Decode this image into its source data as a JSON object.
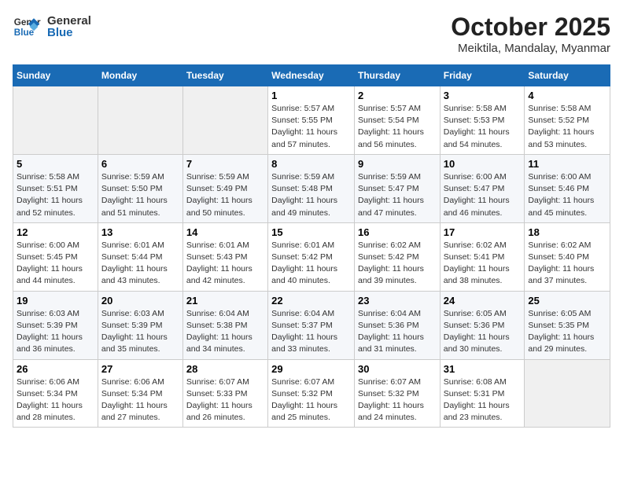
{
  "header": {
    "logo_line1": "General",
    "logo_line2": "Blue",
    "month": "October 2025",
    "location": "Meiktila, Mandalay, Myanmar"
  },
  "days_of_week": [
    "Sunday",
    "Monday",
    "Tuesday",
    "Wednesday",
    "Thursday",
    "Friday",
    "Saturday"
  ],
  "weeks": [
    [
      {
        "day": "",
        "info": ""
      },
      {
        "day": "",
        "info": ""
      },
      {
        "day": "",
        "info": ""
      },
      {
        "day": "1",
        "info": "Sunrise: 5:57 AM\nSunset: 5:55 PM\nDaylight: 11 hours and 57 minutes."
      },
      {
        "day": "2",
        "info": "Sunrise: 5:57 AM\nSunset: 5:54 PM\nDaylight: 11 hours and 56 minutes."
      },
      {
        "day": "3",
        "info": "Sunrise: 5:58 AM\nSunset: 5:53 PM\nDaylight: 11 hours and 54 minutes."
      },
      {
        "day": "4",
        "info": "Sunrise: 5:58 AM\nSunset: 5:52 PM\nDaylight: 11 hours and 53 minutes."
      }
    ],
    [
      {
        "day": "5",
        "info": "Sunrise: 5:58 AM\nSunset: 5:51 PM\nDaylight: 11 hours and 52 minutes."
      },
      {
        "day": "6",
        "info": "Sunrise: 5:59 AM\nSunset: 5:50 PM\nDaylight: 11 hours and 51 minutes."
      },
      {
        "day": "7",
        "info": "Sunrise: 5:59 AM\nSunset: 5:49 PM\nDaylight: 11 hours and 50 minutes."
      },
      {
        "day": "8",
        "info": "Sunrise: 5:59 AM\nSunset: 5:48 PM\nDaylight: 11 hours and 49 minutes."
      },
      {
        "day": "9",
        "info": "Sunrise: 5:59 AM\nSunset: 5:47 PM\nDaylight: 11 hours and 47 minutes."
      },
      {
        "day": "10",
        "info": "Sunrise: 6:00 AM\nSunset: 5:47 PM\nDaylight: 11 hours and 46 minutes."
      },
      {
        "day": "11",
        "info": "Sunrise: 6:00 AM\nSunset: 5:46 PM\nDaylight: 11 hours and 45 minutes."
      }
    ],
    [
      {
        "day": "12",
        "info": "Sunrise: 6:00 AM\nSunset: 5:45 PM\nDaylight: 11 hours and 44 minutes."
      },
      {
        "day": "13",
        "info": "Sunrise: 6:01 AM\nSunset: 5:44 PM\nDaylight: 11 hours and 43 minutes."
      },
      {
        "day": "14",
        "info": "Sunrise: 6:01 AM\nSunset: 5:43 PM\nDaylight: 11 hours and 42 minutes."
      },
      {
        "day": "15",
        "info": "Sunrise: 6:01 AM\nSunset: 5:42 PM\nDaylight: 11 hours and 40 minutes."
      },
      {
        "day": "16",
        "info": "Sunrise: 6:02 AM\nSunset: 5:42 PM\nDaylight: 11 hours and 39 minutes."
      },
      {
        "day": "17",
        "info": "Sunrise: 6:02 AM\nSunset: 5:41 PM\nDaylight: 11 hours and 38 minutes."
      },
      {
        "day": "18",
        "info": "Sunrise: 6:02 AM\nSunset: 5:40 PM\nDaylight: 11 hours and 37 minutes."
      }
    ],
    [
      {
        "day": "19",
        "info": "Sunrise: 6:03 AM\nSunset: 5:39 PM\nDaylight: 11 hours and 36 minutes."
      },
      {
        "day": "20",
        "info": "Sunrise: 6:03 AM\nSunset: 5:39 PM\nDaylight: 11 hours and 35 minutes."
      },
      {
        "day": "21",
        "info": "Sunrise: 6:04 AM\nSunset: 5:38 PM\nDaylight: 11 hours and 34 minutes."
      },
      {
        "day": "22",
        "info": "Sunrise: 6:04 AM\nSunset: 5:37 PM\nDaylight: 11 hours and 33 minutes."
      },
      {
        "day": "23",
        "info": "Sunrise: 6:04 AM\nSunset: 5:36 PM\nDaylight: 11 hours and 31 minutes."
      },
      {
        "day": "24",
        "info": "Sunrise: 6:05 AM\nSunset: 5:36 PM\nDaylight: 11 hours and 30 minutes."
      },
      {
        "day": "25",
        "info": "Sunrise: 6:05 AM\nSunset: 5:35 PM\nDaylight: 11 hours and 29 minutes."
      }
    ],
    [
      {
        "day": "26",
        "info": "Sunrise: 6:06 AM\nSunset: 5:34 PM\nDaylight: 11 hours and 28 minutes."
      },
      {
        "day": "27",
        "info": "Sunrise: 6:06 AM\nSunset: 5:34 PM\nDaylight: 11 hours and 27 minutes."
      },
      {
        "day": "28",
        "info": "Sunrise: 6:07 AM\nSunset: 5:33 PM\nDaylight: 11 hours and 26 minutes."
      },
      {
        "day": "29",
        "info": "Sunrise: 6:07 AM\nSunset: 5:32 PM\nDaylight: 11 hours and 25 minutes."
      },
      {
        "day": "30",
        "info": "Sunrise: 6:07 AM\nSunset: 5:32 PM\nDaylight: 11 hours and 24 minutes."
      },
      {
        "day": "31",
        "info": "Sunrise: 6:08 AM\nSunset: 5:31 PM\nDaylight: 11 hours and 23 minutes."
      },
      {
        "day": "",
        "info": ""
      }
    ]
  ]
}
